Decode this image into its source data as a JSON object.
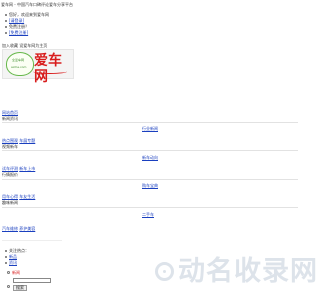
{
  "header": {
    "title": "爱车网 - 中国汽车口碑评论爱车分享平台"
  },
  "user_menu": {
    "greeting": "您好，欢迎来到爱车网",
    "login": "[请登录]",
    "register": "免费注册？",
    "free_register": "[免费注册]"
  },
  "favorites": {
    "add_favorite": "加入收藏",
    "set_homepage": "设爱车网为主页"
  },
  "logo": {
    "badge_text": "全爱车网",
    "badge_sub": "aiche.com",
    "main_text": "爱车网"
  },
  "nav": {
    "home": "网站首页",
    "news_heading": "新闻资讯",
    "industry_news": "行业新闻",
    "hot_topics": "热点围观",
    "auto_show": "车展专题",
    "video": "视频新车",
    "new_car_trends": "新车动向",
    "car_reviews": "试车评测",
    "new_car_launch": "新车上市",
    "price_info": "行情报价",
    "buy_car_guide": "购车宝典",
    "user_car_reviews": "用车心得",
    "car_knowledge": "车友生活",
    "fun_news": "趣味新闻",
    "used_car": "二手车",
    "car_maintenance": "汽车维修",
    "maintenance_beauty": "养护美容",
    "modification": "汽车改装",
    "car_culture": "车模美图"
  },
  "hot": {
    "heading": "关注热点：",
    "items": [
      "新品",
      "资讯"
    ]
  },
  "search": {
    "options": [
      "新闻",
      "产品"
    ],
    "placeholder": "",
    "button": "搜索"
  },
  "watermark": {
    "text": "动名收录网"
  },
  "colors": {
    "link": "#1a3fbf",
    "logo_red": "#d81c1c",
    "logo_green": "#3f8f2d"
  }
}
